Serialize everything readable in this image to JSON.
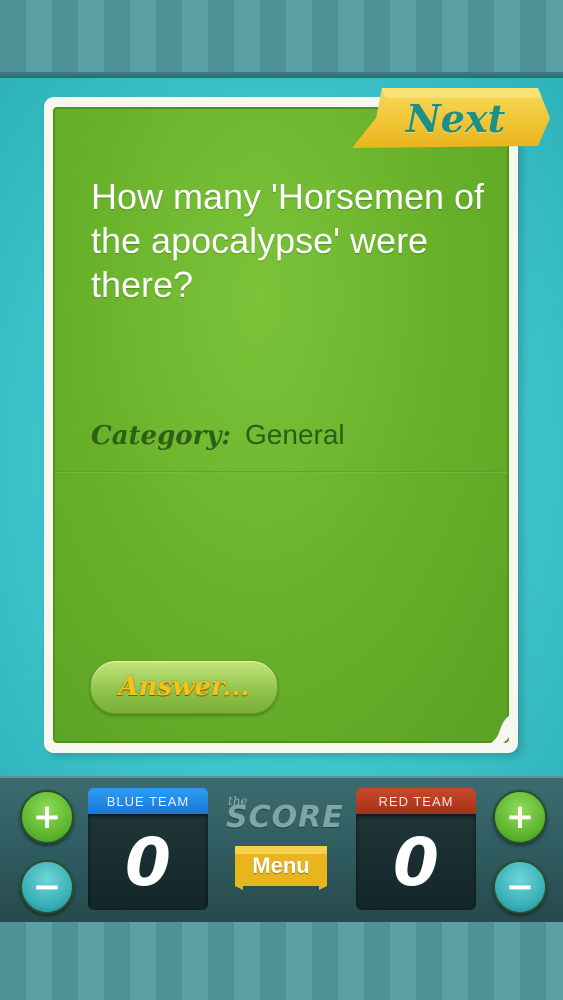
{
  "card": {
    "next_label": "Next",
    "question": "How many 'Horsemen of the apocalypse' were there?",
    "category_label": "Category:",
    "category_value": "General",
    "answer_label": "Answer..."
  },
  "scoreboard": {
    "logo_small": "the",
    "logo": "SCORE",
    "menu_label": "Menu",
    "blue_team": {
      "label": "BLUE TEAM",
      "score": "0"
    },
    "red_team": {
      "label": "RED TEAM",
      "score": "0"
    },
    "plus_symbol": "+",
    "minus_symbol": "−"
  },
  "colors": {
    "card_green": "#68b22a",
    "background_teal": "#3fc6cd",
    "ribbon_yellow": "#f2c42c",
    "blue_team": "#1f86e6",
    "red_team": "#b83d22"
  }
}
